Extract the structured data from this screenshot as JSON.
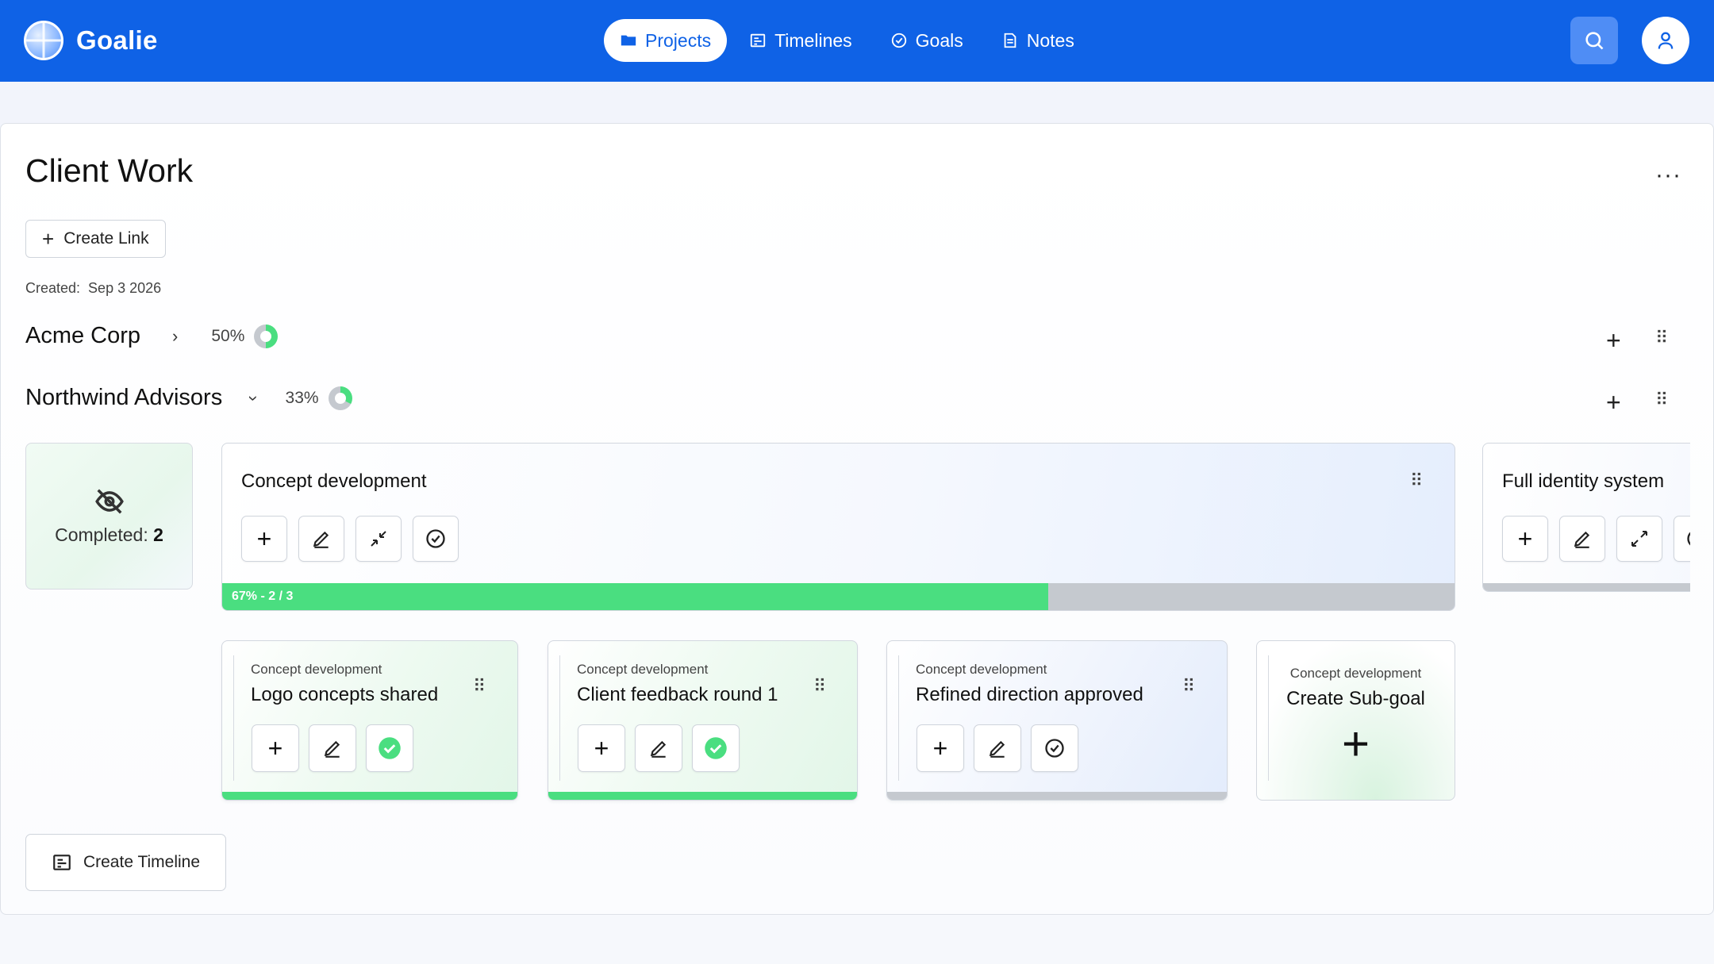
{
  "header": {
    "brand": "Goalie",
    "nav": [
      {
        "label": "Projects",
        "icon": "folder-icon",
        "active": true
      },
      {
        "label": "Timelines",
        "icon": "timeline-icon",
        "active": false
      },
      {
        "label": "Goals",
        "icon": "check-circle-icon",
        "active": false
      },
      {
        "label": "Notes",
        "icon": "note-icon",
        "active": false
      }
    ],
    "search_icon": "search-icon",
    "user_icon": "user-icon",
    "colors": {
      "bar": "#0f62e6",
      "search_bg": "#4f8df5"
    }
  },
  "project": {
    "title": "Client Work",
    "more_label": "···",
    "create_link_label": "Create Link",
    "created_label": "Created:",
    "created_date": "Sep 3 2026"
  },
  "timelines": [
    {
      "name": "Acme Corp",
      "expanded": false,
      "percent_label": "50%",
      "progress": 0.5
    },
    {
      "name": "Northwind Advisors",
      "expanded": true,
      "percent_label": "33%",
      "progress": 0.33
    }
  ],
  "completed": {
    "label": "Completed:",
    "count": "2"
  },
  "goals": [
    {
      "title": "Concept development",
      "progress_label": "67% - 2 / 3",
      "progress": 0.67,
      "subgoals": [
        {
          "parent": "Concept development",
          "title": "Logo concepts shared",
          "done": true
        },
        {
          "parent": "Concept development",
          "title": "Client feedback round 1",
          "done": true
        },
        {
          "parent": "Concept development",
          "title": "Refined direction approved",
          "done": false
        }
      ],
      "create_sub": {
        "parent": "Concept development",
        "label": "Create Sub-goal"
      }
    },
    {
      "title": "Full identity system"
    }
  ],
  "create_timeline_label": "Create Timeline",
  "colors": {
    "green": "#4ade80",
    "gray": "#c5c9cf"
  }
}
